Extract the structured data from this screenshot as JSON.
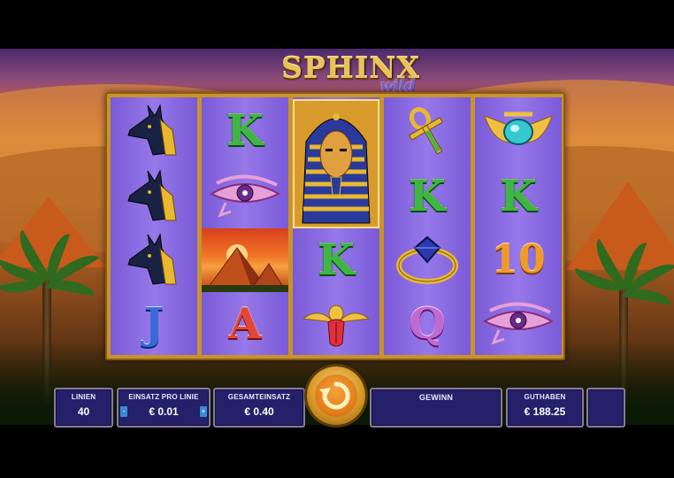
{
  "game": {
    "title_main": "SPHINX",
    "title_sub": "wild"
  },
  "reels": [
    [
      "anubis",
      "anubis",
      "anubis",
      "J"
    ],
    [
      "K",
      "eye-of-horus",
      "pyramid",
      "A"
    ],
    [
      "pharaoh",
      "pharaoh",
      "K",
      "scarab"
    ],
    [
      "ankh",
      "K",
      "ring",
      "Q"
    ],
    [
      "scarab-jewel",
      "K",
      "10",
      "eye-of-horus"
    ]
  ],
  "controls": {
    "lines": {
      "label": "LINIEN",
      "value": "40"
    },
    "bet_per_line": {
      "label": "EINSATZ PRO LINIE",
      "value": "€ 0.01",
      "decrease": "-",
      "increase": "+"
    },
    "total_bet": {
      "label": "GESAMTEINSATZ",
      "value": "€ 0.40"
    },
    "win": {
      "label": "GEWINN",
      "value": ""
    },
    "balance": {
      "label": "GUTHABEN",
      "value": "€ 188.25"
    }
  },
  "colors": {
    "reel_bg": "#8a6ae0",
    "frame_gold": "#c9932c",
    "panel_bg": "#24206a",
    "k_green": "#3fb644",
    "j_blue": "#3a6ad8",
    "a_red": "#e2473a",
    "q_purple": "#c06ad0",
    "ten_orange": "#f09a28"
  },
  "icons": {
    "spin": "spin-arrow-icon"
  }
}
